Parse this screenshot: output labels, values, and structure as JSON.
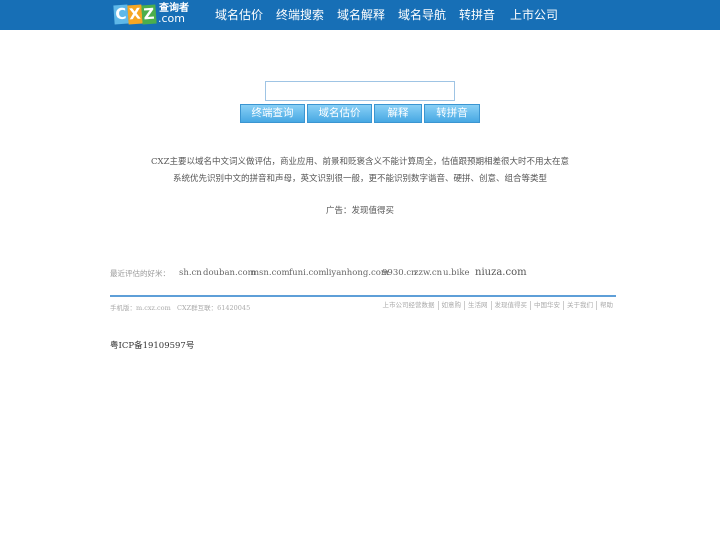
{
  "logo": {
    "tiles": [
      "C",
      "X",
      "Z"
    ],
    "cn_text": "查询者",
    "domain_text": ".com"
  },
  "nav": {
    "items": [
      "域名估价",
      "终端搜索",
      "域名解释",
      "域名导航",
      "转拼音",
      "上市公司"
    ]
  },
  "search": {
    "value": "",
    "placeholder": "",
    "buttons": [
      "终端查询",
      "域名估价",
      "解释",
      "转拼音"
    ]
  },
  "description": {
    "line1": "CXZ主要以域名中文词义做评估，商业应用、前景和贬褒含义不能计算周全，估值跟预期相差很大时不用太在意",
    "line2": "系统优先识别中文的拼音和声母，英文识别很一般，更不能识别数字谐音、硬拼、创意、组合等类型"
  },
  "ad": {
    "prefix": "广告：",
    "link": "发现值得买"
  },
  "recent": {
    "label": "最近评估的好米：",
    "domains": [
      "sh.cn",
      "douban.com",
      "msn.com",
      "funi.com",
      "liyanhong.com",
      "9930.cn",
      "zzw.cn",
      "u.bike",
      "niuza.com"
    ]
  },
  "footer": {
    "mobile": "手机版：m.cxz.com",
    "qq_group": "CXZ群互联：61420045",
    "links": [
      "上市公司经营数据",
      "如意购",
      "生活网",
      "发现值得买",
      "中国华安",
      "关于我们",
      "帮助"
    ]
  },
  "icp": "粤ICP备19109597号"
}
